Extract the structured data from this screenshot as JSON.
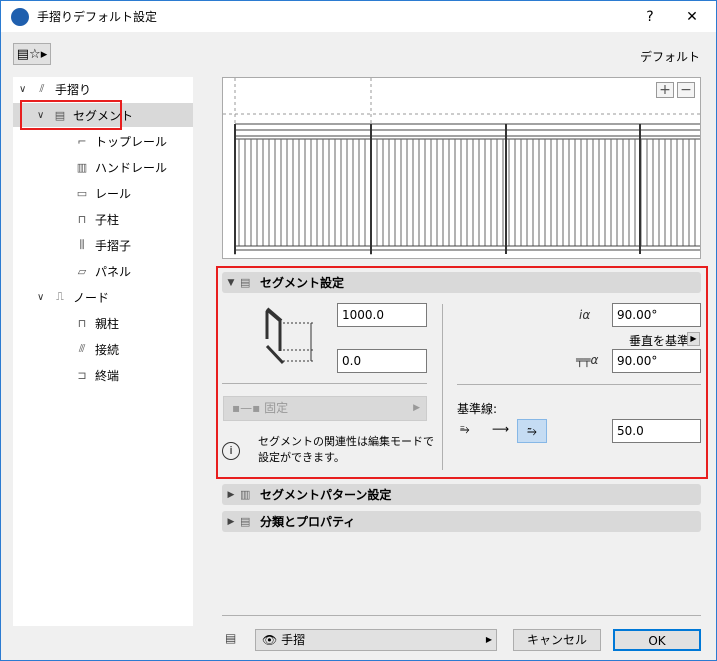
{
  "window": {
    "title": "手摺りデフォルト設定",
    "help": "?",
    "close": "✕"
  },
  "header": {
    "mode_label": "デフォルト"
  },
  "tree": [
    {
      "label": "手摺り",
      "level": 0,
      "expanded": true
    },
    {
      "label": "セグメント",
      "level": 1,
      "expanded": true,
      "selected": true
    },
    {
      "label": "トップレール",
      "level": 2
    },
    {
      "label": "ハンドレール",
      "level": 2
    },
    {
      "label": "レール",
      "level": 2
    },
    {
      "label": "子柱",
      "level": 2
    },
    {
      "label": "手摺子",
      "level": 2
    },
    {
      "label": "パネル",
      "level": 2
    },
    {
      "label": "ノード",
      "level": 1,
      "expanded": true
    },
    {
      "label": "親柱",
      "level": 2
    },
    {
      "label": "接続",
      "level": 2
    },
    {
      "label": "終端",
      "level": 2
    }
  ],
  "preview": {
    "zoom_in": "+",
    "zoom_out": "−"
  },
  "segment_settings": {
    "title": "セグメント設定",
    "height": "1000.0",
    "offset": "0.0",
    "angle1": "90.00°",
    "angle_mode": "垂直を基準",
    "angle2": "90.00°",
    "anchor_label": "固定",
    "info": "セグメントの関連性は編集モードで設定ができます。",
    "info_line1": "セグメントの関連性は編集モードで",
    "info_line2": "設定ができます。",
    "reference_line_label": "基準線:",
    "reference_offset": "50.0"
  },
  "sections": [
    {
      "title": "セグメントパターン設定"
    },
    {
      "title": "分類とプロパティ"
    }
  ],
  "footer": {
    "layer": "手摺",
    "cancel": "キャンセル",
    "ok": "OK"
  }
}
